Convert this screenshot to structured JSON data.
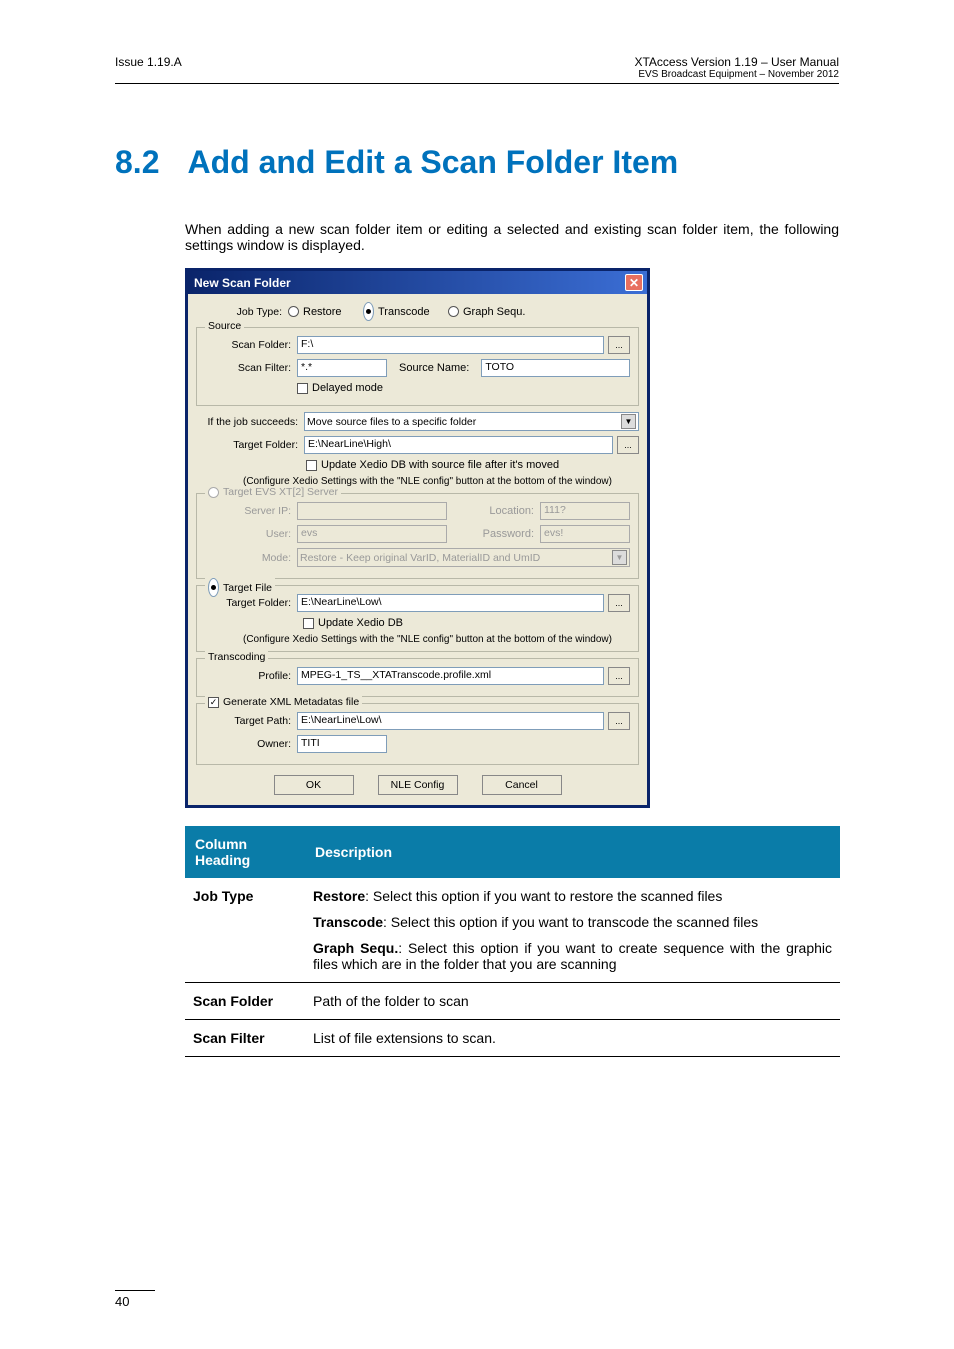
{
  "header": {
    "issue": "Issue 1.19.A",
    "product": "XTAccess  Version 1.19 – User Manual",
    "company": "EVS Broadcast Equipment – November 2012"
  },
  "section": {
    "number": "8.2",
    "title": "Add and Edit a Scan Folder Item"
  },
  "intro": "When adding a new scan folder item or editing a selected and existing scan folder item, the following settings window is displayed.",
  "dialog": {
    "title": "New Scan Folder",
    "jobtype_label": "Job Type:",
    "jobtype_options": {
      "restore": "Restore",
      "transcode": "Transcode",
      "graphsequ": "Graph Sequ."
    },
    "source": {
      "legend": "Source",
      "scan_folder_label": "Scan Folder:",
      "scan_folder_value": "F:\\",
      "scan_filter_label": "Scan Filter:",
      "scan_filter_value": "*.*",
      "source_name_label": "Source Name:",
      "source_name_value": "TOTO",
      "delayed_label": "Delayed mode"
    },
    "succeed": {
      "label": "If the job succeeds:",
      "value": "Move source files to a specific folder",
      "target_folder_label": "Target Folder:",
      "target_folder_value": "E:\\NearLine\\High\\",
      "update_label": "Update Xedio DB with source file after it's moved",
      "note": "(Configure Xedio Settings with the \"NLE config\" button at the bottom of the window)"
    },
    "target_xt": {
      "legend": "Target EVS XT[2] Server",
      "server_ip_label": "Server IP:",
      "location_label": "Location:",
      "location_value": "111?",
      "user_label": "User:",
      "user_value": "evs",
      "password_label": "Password:",
      "password_value": "evs!",
      "mode_label": "Mode:",
      "mode_value": "Restore - Keep original VarID, MaterialID and UmID"
    },
    "target_file": {
      "legend": "Target File",
      "target_folder_label": "Target Folder:",
      "target_folder_value": "E:\\NearLine\\Low\\",
      "update_label": "Update Xedio DB",
      "note": "(Configure Xedio Settings with the \"NLE config\" button at the bottom of the window)"
    },
    "transcoding": {
      "legend": "Transcoding",
      "profile_label": "Profile:",
      "profile_value": "MPEG-1_TS__XTATranscode.profile.xml"
    },
    "metadata": {
      "legend": "Generate XML Metadatas file",
      "target_path_label": "Target Path:",
      "target_path_value": "E:\\NearLine\\Low\\",
      "owner_label": "Owner:",
      "owner_value": "TITI"
    },
    "buttons": {
      "ok": "OK",
      "nle": "NLE Config",
      "cancel": "Cancel"
    }
  },
  "table": {
    "head_col1": "Column Heading",
    "head_col2": "Description",
    "rows": [
      {
        "col1": "Job Type",
        "paras": [
          {
            "bold": "Restore",
            "rest": ": Select this option if you want to restore the scanned files"
          },
          {
            "bold": "Transcode",
            "rest": ": Select this option if you want to transcode the scanned files"
          },
          {
            "bold": "Graph Sequ.",
            "rest": ": Select this option if you want to create sequence with the graphic files which are in the folder that you are scanning"
          }
        ]
      },
      {
        "col1": "Scan Folder",
        "paras": [
          {
            "bold": "",
            "rest": "Path of the folder to scan"
          }
        ]
      },
      {
        "col1": "Scan Filter",
        "paras": [
          {
            "bold": "",
            "rest": "List of file extensions to scan."
          }
        ]
      }
    ]
  },
  "pagenum": "40"
}
